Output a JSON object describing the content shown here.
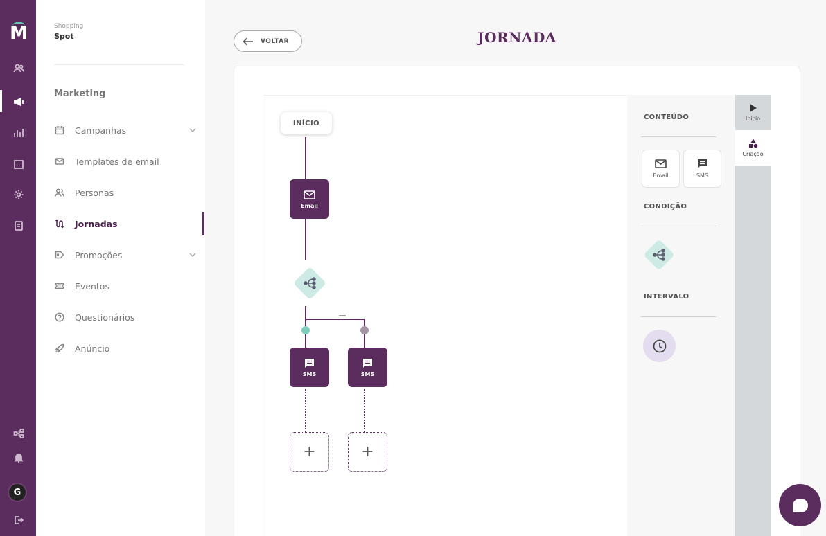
{
  "app": {
    "logo_letter": "M"
  },
  "sidebar": {
    "org_sub": "Shopping",
    "org_name": "Spot",
    "section_title": "Marketing",
    "items": [
      {
        "label": "Campanhas",
        "icon": "calendar-icon",
        "has_chevron": true
      },
      {
        "label": "Templates de email",
        "icon": "mail-icon",
        "has_chevron": false
      },
      {
        "label": "Personas",
        "icon": "users-icon",
        "has_chevron": false
      },
      {
        "label": "Jornadas",
        "icon": "journey-icon",
        "has_chevron": false,
        "active": true
      },
      {
        "label": "Promoções",
        "icon": "tag-icon",
        "has_chevron": true
      },
      {
        "label": "Eventos",
        "icon": "ticket-icon",
        "has_chevron": false
      },
      {
        "label": "Questionários",
        "icon": "question-icon",
        "has_chevron": false
      },
      {
        "label": "Anúncio",
        "icon": "rocket-icon",
        "has_chevron": false
      }
    ]
  },
  "rail": {
    "avatar_letter": "G"
  },
  "header": {
    "back_label": "VOLTAR",
    "title": "JORNADA"
  },
  "flow": {
    "start_label": "INÍCIO",
    "email_label": "Email",
    "sms_left_label": "SMS",
    "sms_right_label": "SMS",
    "add_symbol": "+"
  },
  "palette": {
    "content_title": "CONTEÚDO",
    "email_label": "Email",
    "sms_label": "SMS",
    "condition_title": "CONDIÇÃO",
    "interval_title": "INTERVALO"
  },
  "tabs": {
    "start_label": "Início",
    "creation_label": "Criação"
  },
  "colors": {
    "brand": "#5b2c5e",
    "condition": "#cdeae4",
    "interval": "#e3ddef",
    "branch_yes": "#7fcdbc",
    "branch_no": "#a594a6"
  }
}
